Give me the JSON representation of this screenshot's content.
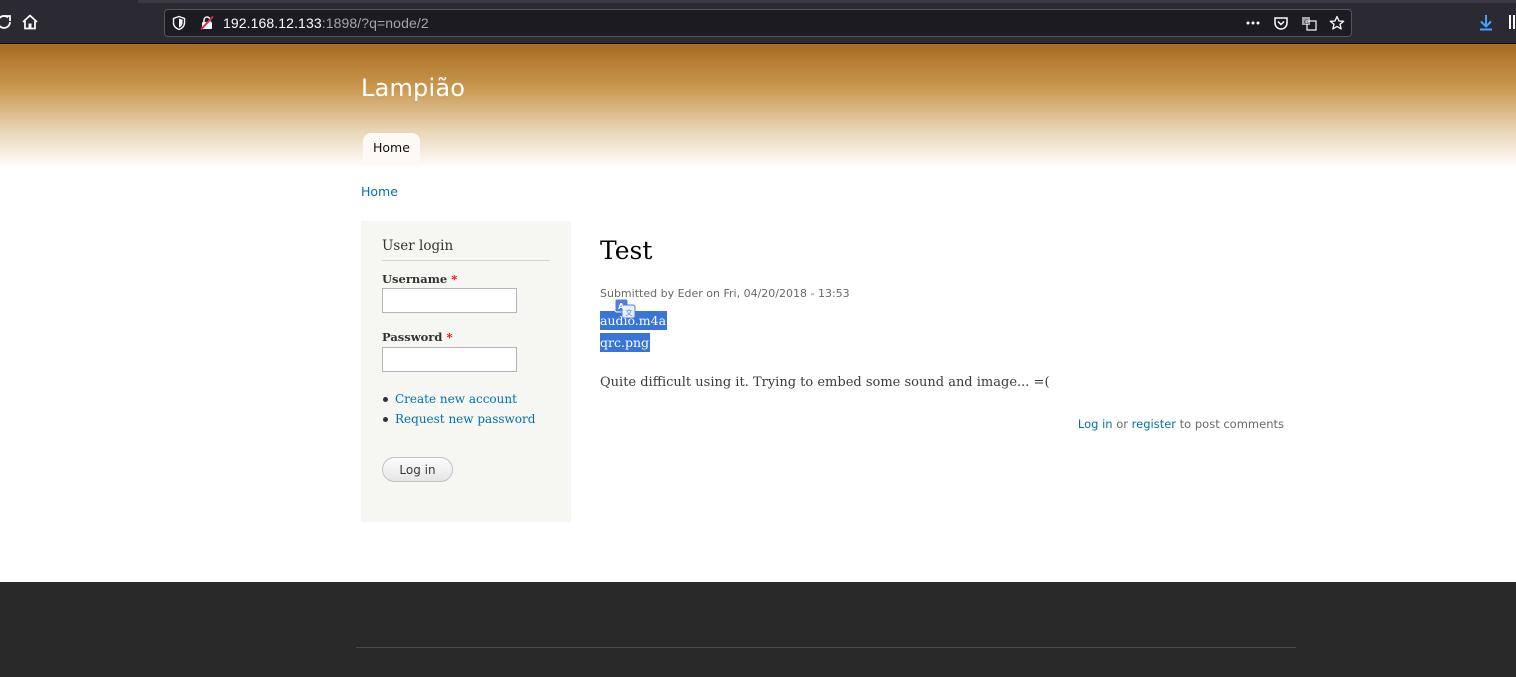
{
  "browser": {
    "url_host": "192.168.12.133",
    "url_rest": ":1898/?q=node/2",
    "icons": [
      "reload-icon",
      "home-icon",
      "shield-icon",
      "insecure-lock-icon",
      "more-icon",
      "pocket-icon",
      "translate-icon",
      "bookmark-star-icon",
      "download-icon",
      "library-icon"
    ]
  },
  "site": {
    "name": "Lampião",
    "tabs": [
      {
        "label": "Home",
        "active": true
      }
    ],
    "breadcrumb": "Home"
  },
  "login_block": {
    "title": "User login",
    "username_label": "Username",
    "password_label": "Password",
    "required_mark": "*",
    "username_value": "",
    "password_value": "",
    "links": [
      "Create new account",
      "Request new password"
    ],
    "submit_label": "Log in"
  },
  "node": {
    "title": "Test",
    "submitted": "Submitted by Eder on Fri, 04/20/2018 - 13:53",
    "files": [
      "audio.m4a",
      "qrc.png"
    ],
    "body": "Quite difficult using it. Trying to embed some sound and image... =(",
    "comments": {
      "login_label": "Log in",
      "or": "or",
      "register_label": "register",
      "suffix": "to post comments"
    }
  },
  "colors": {
    "link": "#0071b3",
    "selection": "#3875d7",
    "header_top": "#a76b21",
    "footer": "#292929"
  }
}
